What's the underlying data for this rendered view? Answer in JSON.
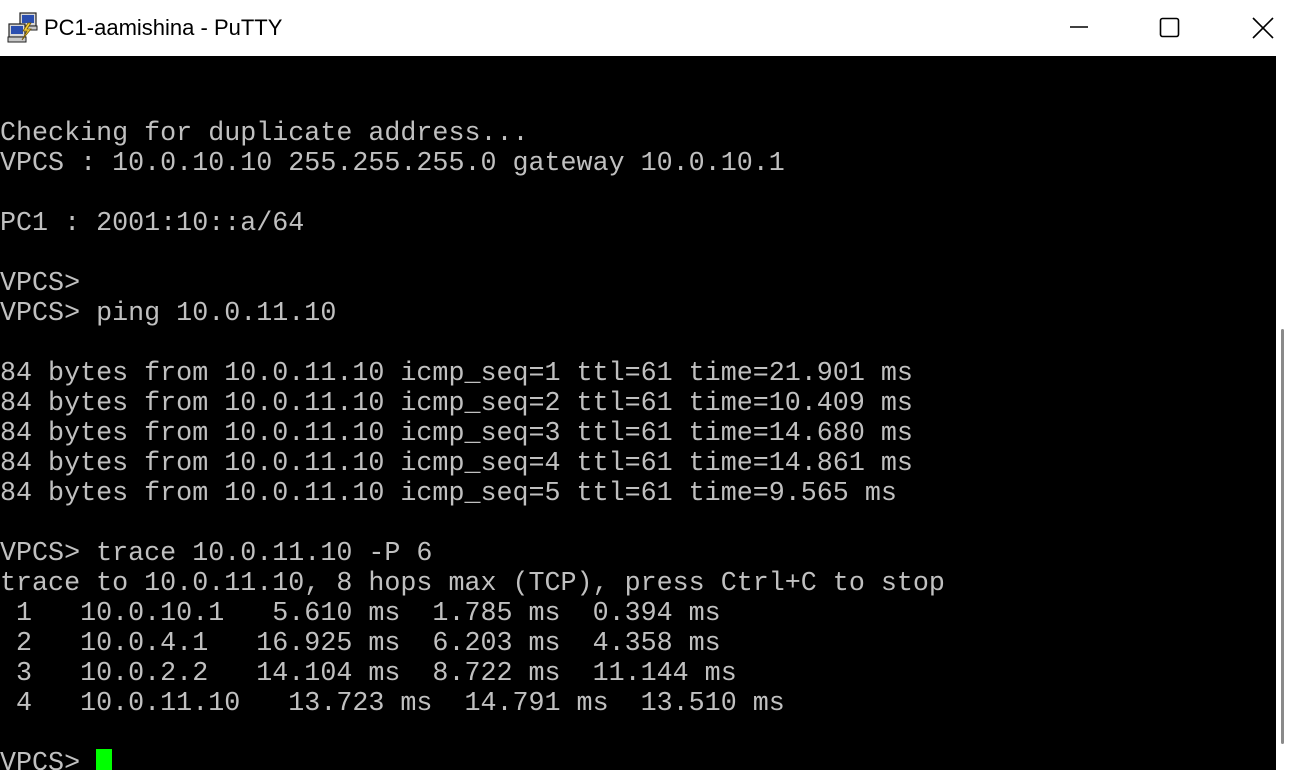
{
  "window": {
    "title": "PC1-aamishina - PuTTY",
    "icon": "putty-icon",
    "controls": {
      "minimize": "minimize-icon",
      "maximize": "maximize-icon",
      "close": "close-icon"
    }
  },
  "terminal": {
    "background": "#000000",
    "foreground": "#c0c0c0",
    "cursor_color": "#00ff00",
    "lines": [
      "",
      "",
      " Checking for duplicate address...",
      " VPCS : 10.0.10.10 255.255.255.0 gateway 10.0.10.1",
      "",
      " PC1 : 2001:10::a/64",
      "",
      " VPCS>",
      " VPCS> ping 10.0.11.10",
      "",
      " 84 bytes from 10.0.11.10 icmp_seq=1 ttl=61 time=21.901 ms",
      " 84 bytes from 10.0.11.10 icmp_seq=2 ttl=61 time=10.409 ms",
      " 84 bytes from 10.0.11.10 icmp_seq=3 ttl=61 time=14.680 ms",
      " 84 bytes from 10.0.11.10 icmp_seq=4 ttl=61 time=14.861 ms",
      " 84 bytes from 10.0.11.10 icmp_seq=5 ttl=61 time=9.565 ms",
      "",
      " VPCS> trace 10.0.11.10 -P 6",
      " trace to 10.0.11.10, 8 hops max (TCP), press Ctrl+C to stop",
      "  1   10.0.10.1   5.610 ms  1.785 ms  0.394 ms",
      "  2   10.0.4.1   16.925 ms  6.203 ms  4.358 ms",
      "  3   10.0.2.2   14.104 ms  8.722 ms  11.144 ms",
      "  4   10.0.11.10   13.723 ms  14.791 ms  13.510 ms",
      ""
    ],
    "prompt": " VPCS> "
  }
}
